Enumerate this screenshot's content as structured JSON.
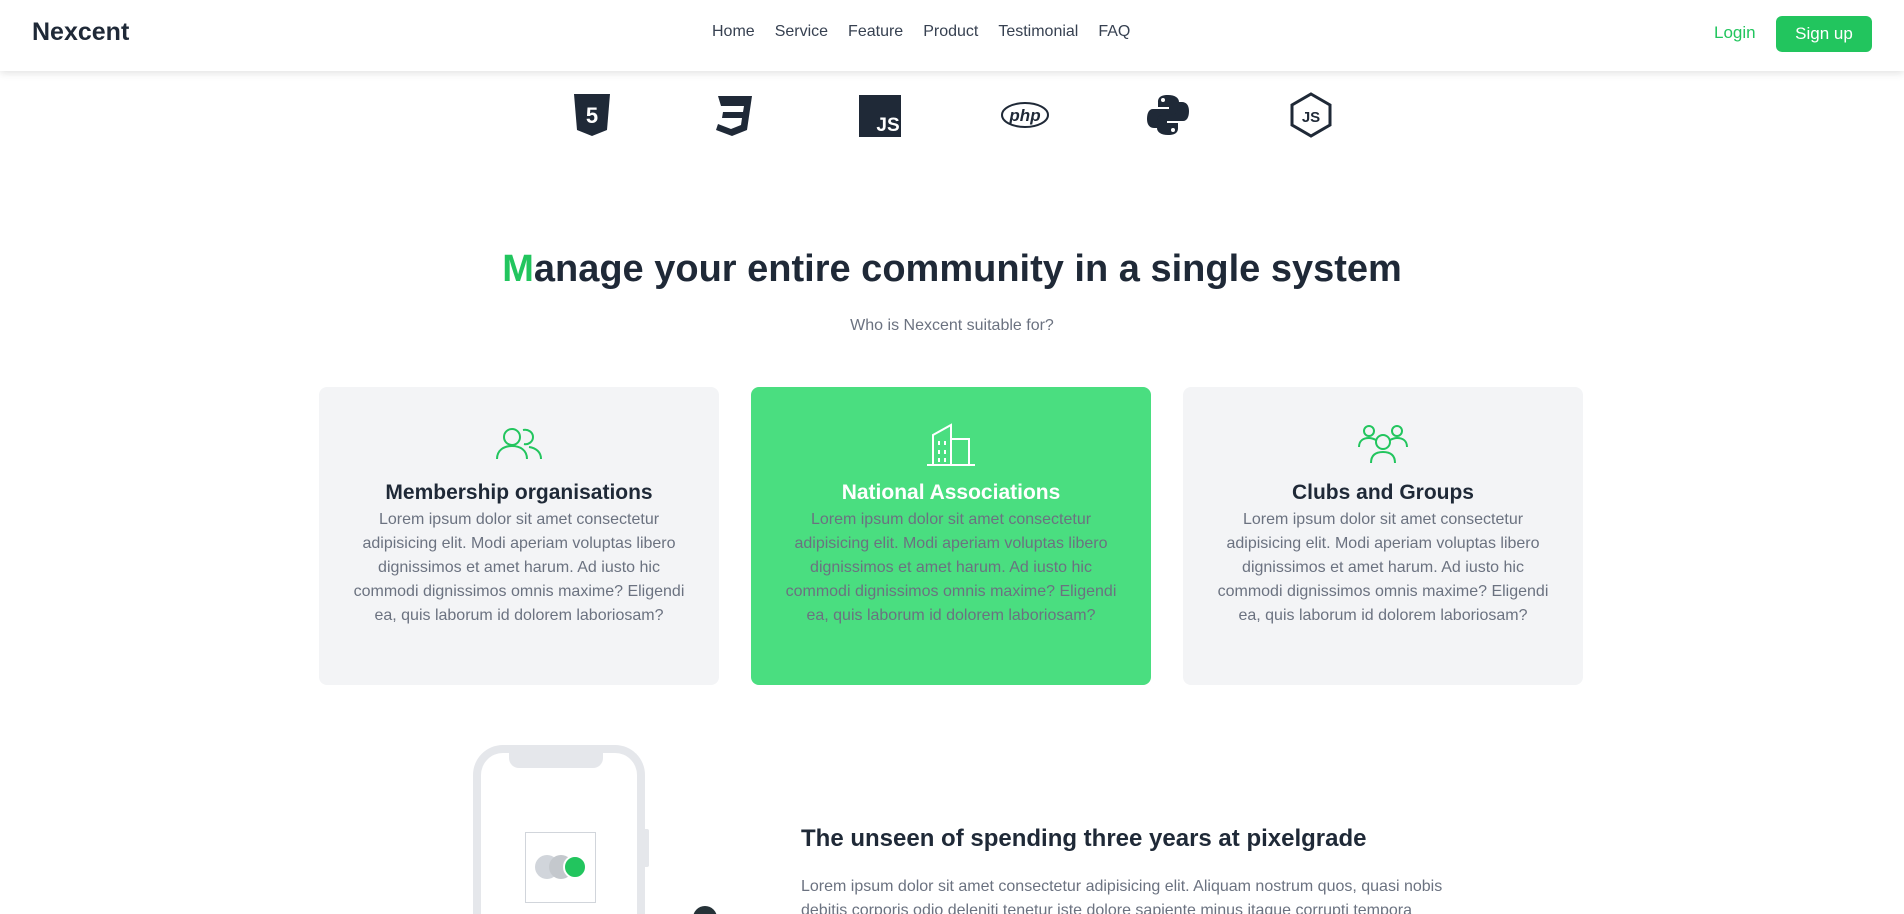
{
  "header": {
    "brand": "Nexcent",
    "nav": [
      "Home",
      "Service",
      "Feature",
      "Product",
      "Testimonial",
      "FAQ"
    ],
    "login_label": "Login",
    "signup_label": "Sign up"
  },
  "logos": [
    {
      "name": "html5-icon",
      "text": "5"
    },
    {
      "name": "css3-icon",
      "text": "3"
    },
    {
      "name": "javascript-icon",
      "text": "JS"
    },
    {
      "name": "php-icon",
      "text": "php"
    },
    {
      "name": "python-icon"
    },
    {
      "name": "nodejs-icon",
      "text": "JS"
    }
  ],
  "community": {
    "title_accent": "M",
    "title_rest": "anage your entire community in a single system",
    "subtitle": "Who is Nexcent suitable for?",
    "cards": [
      {
        "title": "Membership organisations",
        "text": "Lorem ipsum dolor sit amet consectetur adipisicing elit. Modi aperiam voluptas libero dignissimos et amet harum. Ad iusto hic commodi dignissimos omnis maxime? Eligendi ea, quis laborum id dolorem laboriosam?",
        "icon": "users-icon"
      },
      {
        "title": "National Associations",
        "text": "Lorem ipsum dolor sit amet consectetur adipisicing elit. Modi aperiam voluptas libero dignissimos et amet harum. Ad iusto hic commodi dignissimos omnis maxime? Eligendi ea, quis laborum id dolorem laboriosam?",
        "icon": "building-icon"
      },
      {
        "title": "Clubs and Groups",
        "text": "Lorem ipsum dolor sit amet consectetur adipisicing elit. Modi aperiam voluptas libero dignissimos et amet harum. Ad iusto hic commodi dignissimos omnis maxime? Eligendi ea, quis laborum id dolorem laboriosam?",
        "icon": "group-icon"
      }
    ]
  },
  "feature": {
    "title": "The unseen of spending three years at pixelgrade",
    "text": "Lorem ipsum dolor sit amet consectetur adipisicing elit. Aliquam nostrum quos, quasi nobis debitis corporis odio deleniti tenetur iste dolore sapiente minus itaque corrupti tempora"
  },
  "colors": {
    "accent": "#22c55e",
    "card_active": "#4ade80",
    "card_bg": "#f3f4f6"
  }
}
